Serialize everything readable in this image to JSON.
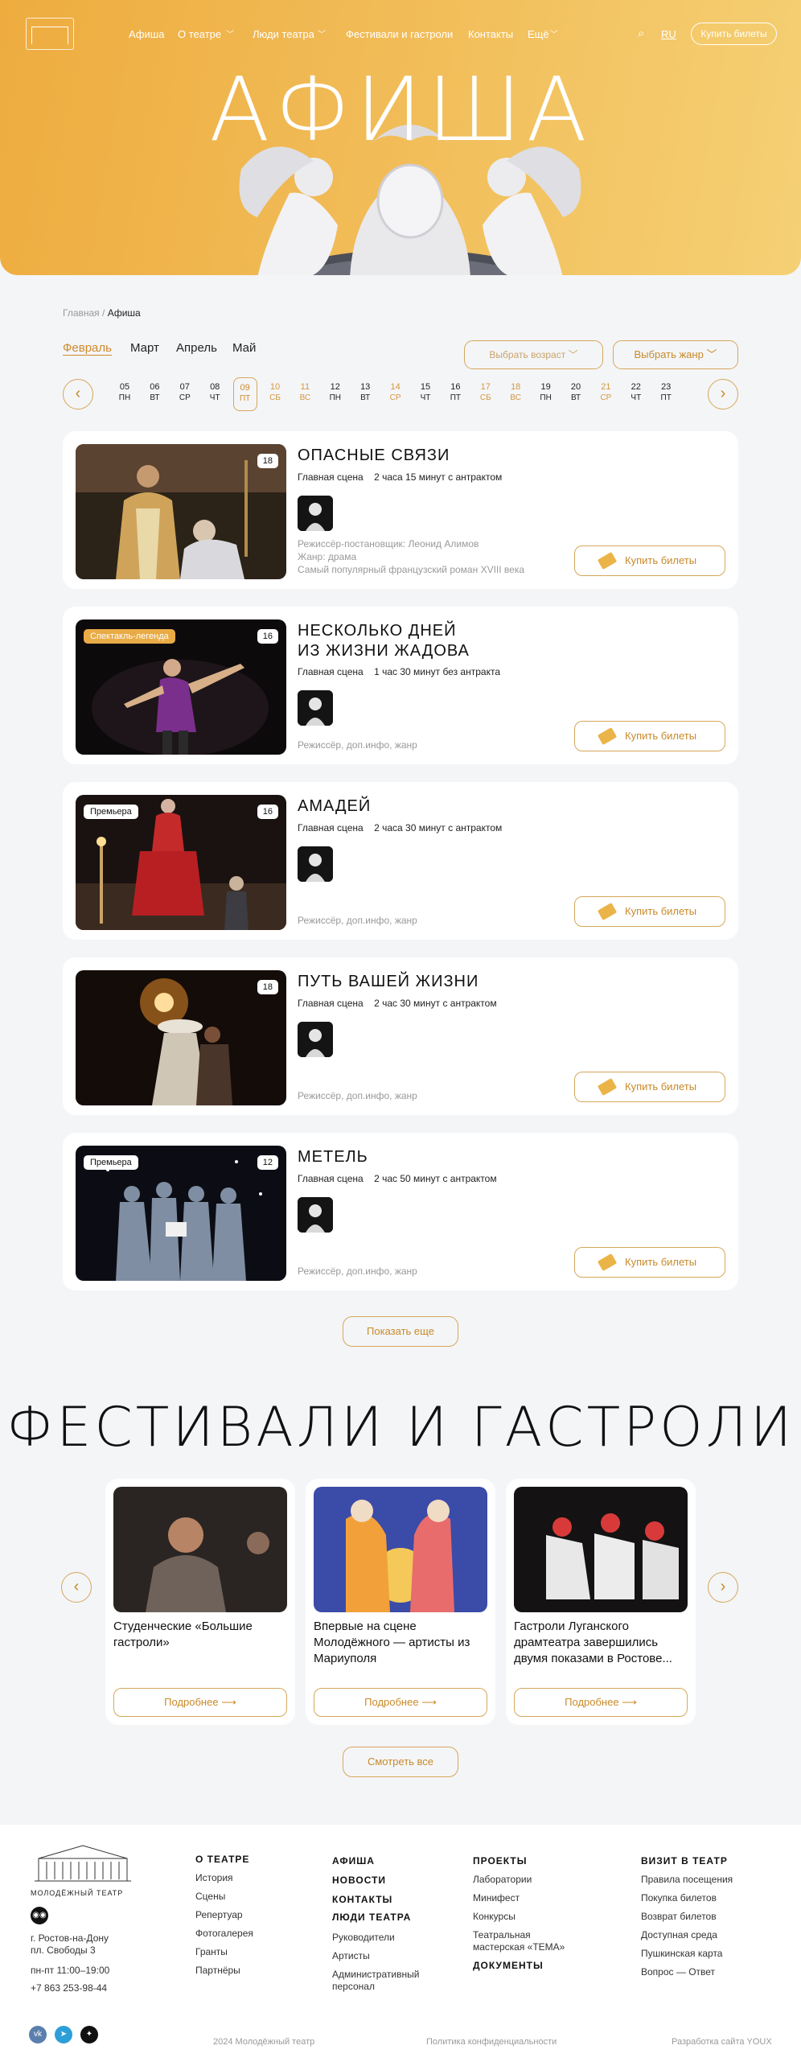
{
  "nav": {
    "items": [
      "Афиша",
      "О театре",
      "Люди театра",
      "Фестивали и гастроли",
      "Контакты",
      "Ещё"
    ],
    "lang": "RU",
    "buy": "Купить билеты"
  },
  "hero": {
    "title": "АФИША"
  },
  "breadcrumb": {
    "home": "Главная",
    "sep": "/",
    "current": "Афиша"
  },
  "months": [
    "Февраль",
    "Март",
    "Апрель",
    "Май"
  ],
  "filters": {
    "age": "Выбрать возраст",
    "genre": "Выбрать жанр"
  },
  "days": [
    {
      "n": "05",
      "w": "ПН"
    },
    {
      "n": "06",
      "w": "ВТ"
    },
    {
      "n": "07",
      "w": "СР"
    },
    {
      "n": "08",
      "w": "ЧТ"
    },
    {
      "n": "09",
      "w": "ПТ"
    },
    {
      "n": "10",
      "w": "СБ"
    },
    {
      "n": "11",
      "w": "ВС"
    },
    {
      "n": "12",
      "w": "ПН"
    },
    {
      "n": "13",
      "w": "ВТ"
    },
    {
      "n": "14",
      "w": "СР"
    },
    {
      "n": "15",
      "w": "ЧТ"
    },
    {
      "n": "16",
      "w": "ПТ"
    },
    {
      "n": "17",
      "w": "СБ"
    },
    {
      "n": "18",
      "w": "ВС"
    },
    {
      "n": "19",
      "w": "ПН"
    },
    {
      "n": "20",
      "w": "ВТ"
    },
    {
      "n": "21",
      "w": "СР"
    },
    {
      "n": "22",
      "w": "ЧТ"
    },
    {
      "n": "23",
      "w": "ПТ"
    }
  ],
  "events": [
    {
      "title": "Опасные связи",
      "age": "18",
      "tag": "",
      "stage": "Главная сцена",
      "duration": "2 часа 15 минут с антрактом",
      "info": [
        "Режиссёр-постановщик: Леонид Алимов",
        "Жанр: драма",
        "Самый популярный французский роман XVIII века"
      ],
      "buy": "Купить билеты"
    },
    {
      "title": "Несколько дней из жизни Жадова",
      "age": "16",
      "tag": "Спектакль-легенда",
      "stage": "Главная сцена",
      "duration": "1 час 30 минут без антракта",
      "info": [
        "Режиссёр, доп.инфо, жанр"
      ],
      "buy": "Купить билеты"
    },
    {
      "title": "Амадей",
      "age": "16",
      "tag": "Премьера",
      "stage": "Главная сцена",
      "duration": "2 часа 30 минут с антрактом",
      "info": [
        "Режиссёр, доп.инфо, жанр"
      ],
      "buy": "Купить билеты"
    },
    {
      "title": "Путь вашей жизни",
      "age": "18",
      "tag": "",
      "stage": "Главная сцена",
      "duration": "2 час 30 минут с антрактом",
      "info": [
        "Режиссёр, доп.инфо, жанр"
      ],
      "buy": "Купить билеты"
    },
    {
      "title": "Метель",
      "age": "12",
      "tag": "Премьера",
      "stage": "Главная сцена",
      "duration": "2 час 50 минут с антрактом",
      "info": [
        "Режиссёр, доп.инфо, жанр"
      ],
      "buy": "Купить билеты"
    }
  ],
  "show_more": "Показать еще",
  "fest": {
    "title": "ФЕСТИВАЛИ И ГАСТРОЛИ",
    "cards": [
      {
        "title": "Студенческие «Большие гастроли»",
        "more": "Подробнее"
      },
      {
        "title": "Впервые на сцене Молодёжного — артисты из Мариуполя",
        "more": "Подробнее"
      },
      {
        "title": "Гастроли Луганского драмтеатра завершились двумя показами в Ростове...",
        "more": "Подробнее"
      }
    ],
    "see_all": "Смотреть все"
  },
  "footer": {
    "logo_text": "МОЛОДЁЖНЫЙ ТЕАТР",
    "address": [
      "г. Ростов-на-Дону",
      "пл. Свободы 3"
    ],
    "hours": "пн-пт 11:00–19:00",
    "phone": "+7 863 253-98-44",
    "about": {
      "h": "О ТЕАТРЕ",
      "items": [
        "История",
        "Сцены",
        "Репертуар",
        "Фотогалерея",
        "Гранты",
        "Партнёры"
      ]
    },
    "mid": {
      "h": [
        "АФИША",
        "НОВОСТИ",
        "КОНТАКТЫ",
        "ЛЮДИ ТЕАТРА"
      ],
      "items": [
        "Руководители",
        "Артисты",
        "Административный персонал"
      ]
    },
    "projects": {
      "h": "ПРОЕКТЫ",
      "items": [
        "Лаборатории",
        "Минифест",
        "Конкурсы",
        "Театральная мастерская «ТЕМА»"
      ],
      "docs": "ДОКУМЕНТЫ"
    },
    "visit": {
      "h": "ВИЗИТ В ТЕАТР",
      "items": [
        "Правила посещения",
        "Покупка билетов",
        "Возврат билетов",
        "Доступная среда",
        "Пушкинская карта",
        "Вопрос — Ответ"
      ]
    },
    "copyright": "2024 Молодёжный театр",
    "policy": "Политика конфиденциальности",
    "dev": "Разработка сайта YOUX"
  }
}
